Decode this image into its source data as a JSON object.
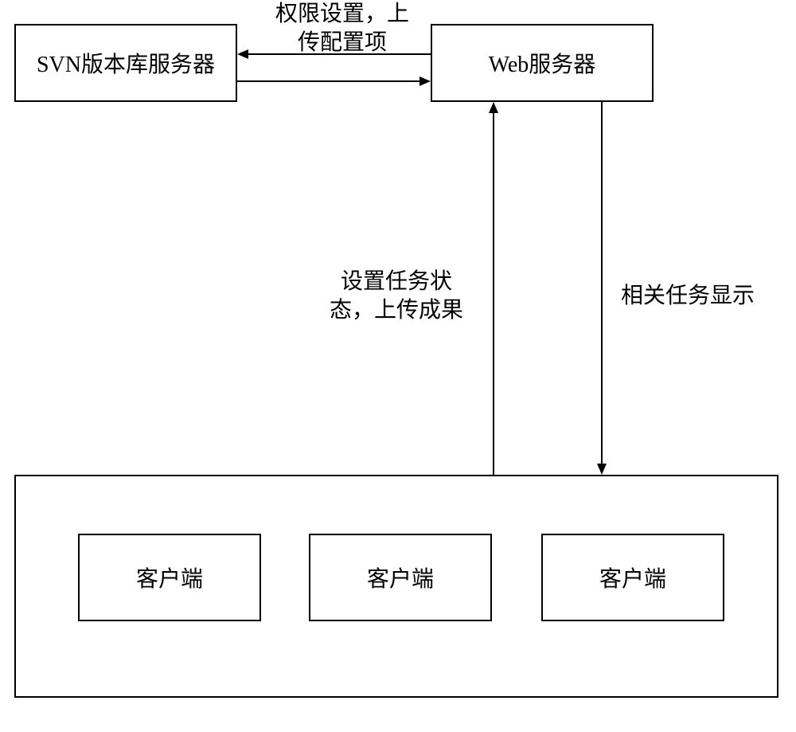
{
  "boxes": {
    "svn_server": "SVN版本库服务器",
    "web_server": "Web服务器",
    "client_1": "客户端",
    "client_2": "客户端",
    "client_3": "客户端"
  },
  "labels": {
    "top_label_line1": "权限设置，上",
    "top_label_line2": "传配置项",
    "mid_left_line1": "设置任务状",
    "mid_left_line2": "态，上传成果",
    "mid_right": "相关任务显示"
  }
}
